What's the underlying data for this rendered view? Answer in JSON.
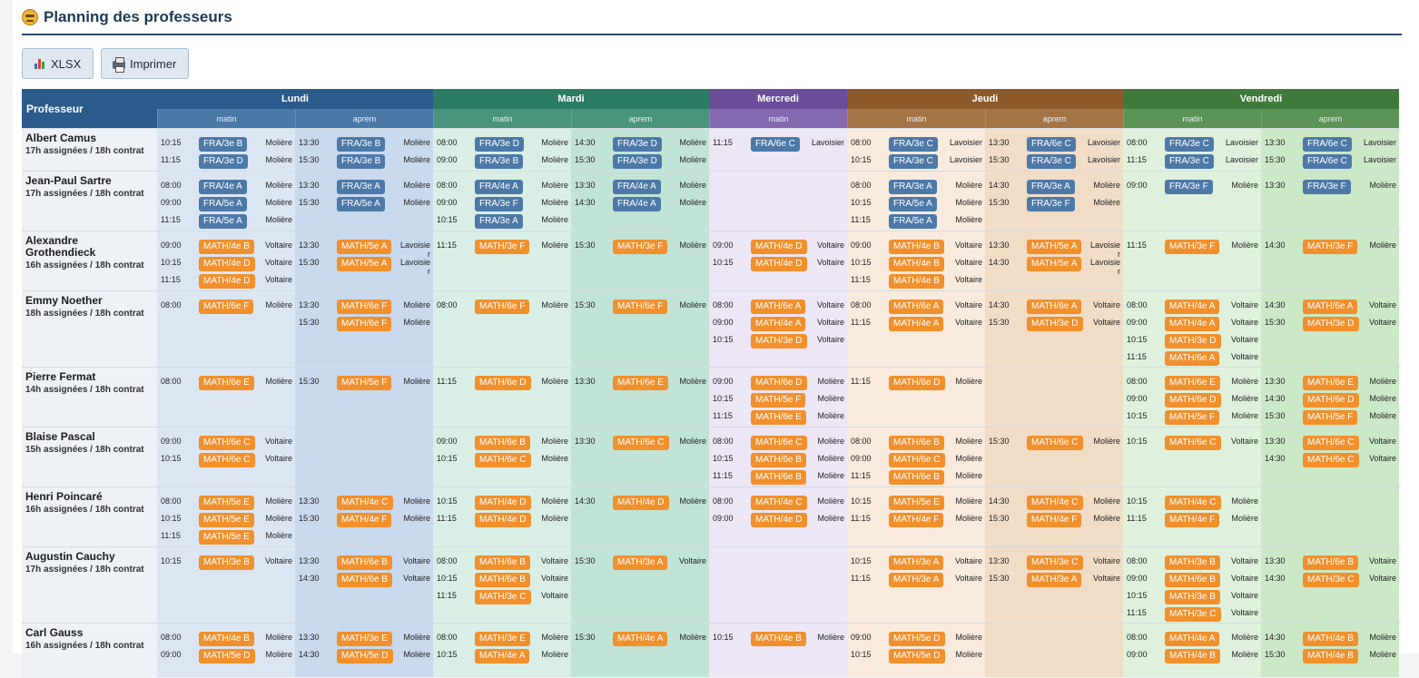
{
  "title": "Planning des professeurs",
  "toolbar": {
    "xlsx_label": "XLSX",
    "print_label": "Imprimer"
  },
  "table": {
    "prof_header": "Professeur",
    "days": [
      {
        "name": "Lundi",
        "color": "#2b5b8a",
        "sub_color": "#4a79a8",
        "slots": [
          "matin",
          "aprem"
        ]
      },
      {
        "name": "Mardi",
        "color": "#2a7c64",
        "sub_color": "#4a937c",
        "slots": [
          "matin",
          "aprem"
        ]
      },
      {
        "name": "Mercredi",
        "color": "#6a4c9b",
        "sub_color": "#8469b0",
        "slots": [
          "matin"
        ]
      },
      {
        "name": "Jeudi",
        "color": "#8c5a2a",
        "sub_color": "#a37446",
        "slots": [
          "matin",
          "aprem"
        ]
      },
      {
        "name": "Vendredi",
        "color": "#3f7a3a",
        "sub_color": "#5c9456",
        "slots": [
          "matin",
          "aprem"
        ]
      }
    ],
    "slot_bgs": [
      "#dce6f3",
      "#c9d9ee",
      "#d9efe5",
      "#c1e4d6",
      "#ece6f5",
      "#f8eadc",
      "#f1dcc6",
      "#dff1dc",
      "#cbe8c7"
    ],
    "professors": [
      {
        "name": "Albert Camus",
        "info": "17h assignées / 18h contrat",
        "slots": [
          [
            [
              "10:15",
              "FRA/3e B",
              "Molière"
            ],
            [
              "11:15",
              "FRA/3e D",
              "Molière"
            ]
          ],
          [
            [
              "13:30",
              "FRA/3e B",
              "Molière"
            ],
            [
              "15:30",
              "FRA/3e B",
              "Molière"
            ]
          ],
          [
            [
              "08:00",
              "FRA/3e D",
              "Molière"
            ],
            [
              "09:00",
              "FRA/3e B",
              "Molière"
            ]
          ],
          [
            [
              "14:30",
              "FRA/3e D",
              "Molière"
            ],
            [
              "15:30",
              "FRA/3e D",
              "Molière"
            ]
          ],
          [
            [
              "11:15",
              "FRA/6e C",
              "Lavoisier"
            ]
          ],
          [
            [
              "08:00",
              "FRA/3e C",
              "Lavoisier"
            ],
            [
              "10:15",
              "FRA/3e C",
              "Lavoisier"
            ]
          ],
          [
            [
              "13:30",
              "FRA/6e C",
              "Lavoisier"
            ],
            [
              "15:30",
              "FRA/3e C",
              "Lavoisier"
            ]
          ],
          [
            [
              "08:00",
              "FRA/3e C",
              "Lavoisier"
            ],
            [
              "11:15",
              "FRA/3e C",
              "Lavoisier"
            ]
          ],
          [
            [
              "13:30",
              "FRA/6e C",
              "Lavoisier"
            ],
            [
              "15:30",
              "FRA/6e C",
              "Lavoisier"
            ]
          ]
        ]
      },
      {
        "name": "Jean-Paul Sartre",
        "info": "17h assignées / 18h contrat",
        "slots": [
          [
            [
              "08:00",
              "FRA/4e A",
              "Molière"
            ],
            [
              "09:00",
              "FRA/5e A",
              "Molière"
            ],
            [
              "11:15",
              "FRA/5e A",
              "Molière"
            ]
          ],
          [
            [
              "13:30",
              "FRA/3e A",
              "Molière"
            ],
            [
              "15:30",
              "FRA/5e A",
              "Molière"
            ]
          ],
          [
            [
              "08:00",
              "FRA/4e A",
              "Molière"
            ],
            [
              "09:00",
              "FRA/3e F",
              "Molière"
            ],
            [
              "10:15",
              "FRA/3e A",
              "Molière"
            ]
          ],
          [
            [
              "13:30",
              "FRA/4e A",
              "Molière"
            ],
            [
              "14:30",
              "FRA/4e A",
              "Molière"
            ]
          ],
          [],
          [
            [
              "08:00",
              "FRA/3e A",
              "Molière"
            ],
            [
              "10:15",
              "FRA/5e A",
              "Molière"
            ],
            [
              "11:15",
              "FRA/5e A",
              "Molière"
            ]
          ],
          [
            [
              "14:30",
              "FRA/3e A",
              "Molière"
            ],
            [
              "15:30",
              "FRA/3e F",
              "Molière"
            ]
          ],
          [
            [
              "09:00",
              "FRA/3e F",
              "Molière"
            ]
          ],
          [
            [
              "13:30",
              "FRA/3e F",
              "Molière"
            ]
          ]
        ]
      },
      {
        "name": "Alexandre Grothendieck",
        "info": "16h assignées / 18h contrat",
        "slots": [
          [
            [
              "09:00",
              "MATH/4e B",
              "Voltaire"
            ],
            [
              "10:15",
              "MATH/4e D",
              "Voltaire"
            ],
            [
              "11:15",
              "MATH/4e D",
              "Voltaire"
            ]
          ],
          [
            [
              "13:30",
              "MATH/5e A",
              "Lavoisier"
            ],
            [
              "15:30",
              "MATH/5e A",
              "Lavoisier"
            ]
          ],
          [
            [
              "11:15",
              "MATH/3e F",
              "Molière"
            ]
          ],
          [
            [
              "15:30",
              "MATH/3e F",
              "Molière"
            ]
          ],
          [
            [
              "09:00",
              "MATH/4e D",
              "Voltaire"
            ],
            [
              "10:15",
              "MATH/4e D",
              "Voltaire"
            ]
          ],
          [
            [
              "09:00",
              "MATH/4e B",
              "Voltaire"
            ],
            [
              "10:15",
              "MATH/4e B",
              "Voltaire"
            ],
            [
              "11:15",
              "MATH/4e B",
              "Voltaire"
            ]
          ],
          [
            [
              "13:30",
              "MATH/5e A",
              "Lavoisier"
            ],
            [
              "14:30",
              "MATH/5e A",
              "Lavoisier"
            ]
          ],
          [
            [
              "11:15",
              "MATH/3e F",
              "Molière"
            ]
          ],
          [
            [
              "14:30",
              "MATH/3e F",
              "Molière"
            ]
          ]
        ]
      },
      {
        "name": "Emmy Noether",
        "info": "18h assignées / 18h contrat",
        "slots": [
          [
            [
              "08:00",
              "MATH/6e F",
              "Molière"
            ]
          ],
          [
            [
              "13:30",
              "MATH/6e F",
              "Molière"
            ],
            [
              "15:30",
              "MATH/6e F",
              "Molière"
            ]
          ],
          [
            [
              "08:00",
              "MATH/6e F",
              "Molière"
            ]
          ],
          [
            [
              "15:30",
              "MATH/6e F",
              "Molière"
            ]
          ],
          [
            [
              "08:00",
              "MATH/6e A",
              "Voltaire"
            ],
            [
              "09:00",
              "MATH/4e A",
              "Voltaire"
            ],
            [
              "10:15",
              "MATH/3e D",
              "Voltaire"
            ]
          ],
          [
            [
              "08:00",
              "MATH/6e A",
              "Voltaire"
            ],
            [
              "11:15",
              "MATH/4e A",
              "Voltaire"
            ]
          ],
          [
            [
              "14:30",
              "MATH/6e A",
              "Voltaire"
            ],
            [
              "15:30",
              "MATH/3e D",
              "Voltaire"
            ]
          ],
          [
            [
              "08:00",
              "MATH/4e A",
              "Voltaire"
            ],
            [
              "09:00",
              "MATH/4e A",
              "Voltaire"
            ],
            [
              "10:15",
              "MATH/3e D",
              "Voltaire"
            ],
            [
              "11:15",
              "MATH/6e A",
              "Voltaire"
            ]
          ],
          [
            [
              "14:30",
              "MATH/6e A",
              "Voltaire"
            ],
            [
              "15:30",
              "MATH/3e D",
              "Voltaire"
            ]
          ]
        ]
      },
      {
        "name": "Pierre Fermat",
        "info": "14h assignées / 18h contrat",
        "slots": [
          [
            [
              "08:00",
              "MATH/6e E",
              "Molière"
            ]
          ],
          [
            [
              "15:30",
              "MATH/5e F",
              "Molière"
            ]
          ],
          [
            [
              "11:15",
              "MATH/6e D",
              "Molière"
            ]
          ],
          [
            [
              "13:30",
              "MATH/6e E",
              "Molière"
            ]
          ],
          [
            [
              "09:00",
              "MATH/6e D",
              "Molière"
            ],
            [
              "10:15",
              "MATH/5e F",
              "Molière"
            ],
            [
              "11:15",
              "MATH/6e E",
              "Molière"
            ]
          ],
          [
            [
              "11:15",
              "MATH/6e D",
              "Molière"
            ]
          ],
          [],
          [
            [
              "08:00",
              "MATH/6e E",
              "Molière"
            ],
            [
              "09:00",
              "MATH/6e D",
              "Molière"
            ],
            [
              "10:15",
              "MATH/5e F",
              "Molière"
            ]
          ],
          [
            [
              "13:30",
              "MATH/6e E",
              "Molière"
            ],
            [
              "14:30",
              "MATH/6e D",
              "Molière"
            ],
            [
              "15:30",
              "MATH/5e F",
              "Molière"
            ]
          ]
        ]
      },
      {
        "name": "Blaise Pascal",
        "info": "15h assignées / 18h contrat",
        "slots": [
          [
            [
              "09:00",
              "MATH/6e C",
              "Voltaire"
            ],
            [
              "10:15",
              "MATH/6e C",
              "Voltaire"
            ]
          ],
          [],
          [
            [
              "09:00",
              "MATH/6e B",
              "Molière"
            ],
            [
              "10:15",
              "MATH/6e C",
              "Molière"
            ]
          ],
          [
            [
              "13:30",
              "MATH/6e C",
              "Molière"
            ]
          ],
          [
            [
              "08:00",
              "MATH/6e C",
              "Molière"
            ],
            [
              "10:15",
              "MATH/6e B",
              "Molière"
            ],
            [
              "11:15",
              "MATH/6e B",
              "Molière"
            ]
          ],
          [
            [
              "08:00",
              "MATH/6e B",
              "Molière"
            ],
            [
              "09:00",
              "MATH/6e C",
              "Molière"
            ],
            [
              "11:15",
              "MATH/6e B",
              "Molière"
            ]
          ],
          [
            [
              "15:30",
              "MATH/6e C",
              "Molière"
            ]
          ],
          [
            [
              "10:15",
              "MATH/6e C",
              "Voltaire"
            ]
          ],
          [
            [
              "13:30",
              "MATH/6e C",
              "Voltaire"
            ],
            [
              "14:30",
              "MATH/6e C",
              "Voltaire"
            ]
          ]
        ]
      },
      {
        "name": "Henri Poincaré",
        "info": "16h assignées / 18h contrat",
        "slots": [
          [
            [
              "08:00",
              "MATH/5e E",
              "Molière"
            ],
            [
              "10:15",
              "MATH/5e E",
              "Molière"
            ],
            [
              "11:15",
              "MATH/5e E",
              "Molière"
            ]
          ],
          [
            [
              "13:30",
              "MATH/4e C",
              "Molière"
            ],
            [
              "15:30",
              "MATH/4e F",
              "Molière"
            ]
          ],
          [
            [
              "10:15",
              "MATH/4e D",
              "Molière"
            ],
            [
              "11:15",
              "MATH/4e D",
              "Molière"
            ]
          ],
          [
            [
              "14:30",
              "MATH/4e D",
              "Molière"
            ]
          ],
          [
            [
              "08:00",
              "MATH/4e C",
              "Molière"
            ],
            [
              "09:00",
              "MATH/4e D",
              "Molière"
            ]
          ],
          [
            [
              "10:15",
              "MATH/5e E",
              "Molière"
            ],
            [
              "11:15",
              "MATH/4e F",
              "Molière"
            ]
          ],
          [
            [
              "14:30",
              "MATH/4e C",
              "Molière"
            ],
            [
              "15:30",
              "MATH/4e F",
              "Molière"
            ]
          ],
          [
            [
              "10:15",
              "MATH/4e C",
              "Molière"
            ],
            [
              "11:15",
              "MATH/4e F",
              "Molière"
            ]
          ],
          []
        ]
      },
      {
        "name": "Augustin Cauchy",
        "info": "17h assignées / 18h contrat",
        "slots": [
          [
            [
              "10:15",
              "MATH/3e B",
              "Voltaire"
            ]
          ],
          [
            [
              "13:30",
              "MATH/6e B",
              "Voltaire"
            ],
            [
              "14:30",
              "MATH/6e B",
              "Voltaire"
            ]
          ],
          [
            [
              "08:00",
              "MATH/6e B",
              "Voltaire"
            ],
            [
              "10:15",
              "MATH/6e B",
              "Voltaire"
            ],
            [
              "11:15",
              "MATH/3e C",
              "Voltaire"
            ]
          ],
          [
            [
              "15:30",
              "MATH/3e A",
              "Voltaire"
            ]
          ],
          [],
          [
            [
              "10:15",
              "MATH/3e A",
              "Voltaire"
            ],
            [
              "11:15",
              "MATH/3e A",
              "Voltaire"
            ]
          ],
          [
            [
              "13:30",
              "MATH/3e C",
              "Voltaire"
            ],
            [
              "15:30",
              "MATH/3e A",
              "Voltaire"
            ]
          ],
          [
            [
              "08:00",
              "MATH/3e B",
              "Voltaire"
            ],
            [
              "09:00",
              "MATH/6e B",
              "Voltaire"
            ],
            [
              "10:15",
              "MATH/3e B",
              "Voltaire"
            ],
            [
              "11:15",
              "MATH/3e C",
              "Voltaire"
            ]
          ],
          [
            [
              "13:30",
              "MATH/6e B",
              "Voltaire"
            ],
            [
              "14:30",
              "MATH/3e C",
              "Voltaire"
            ]
          ]
        ]
      },
      {
        "name": "Carl Gauss",
        "info": "16h assignées / 18h contrat",
        "slots": [
          [
            [
              "08:00",
              "MATH/4e B",
              "Molière"
            ],
            [
              "09:00",
              "MATH/5e D",
              "Molière"
            ]
          ],
          [
            [
              "13:30",
              "MATH/3e E",
              "Molière"
            ],
            [
              "14:30",
              "MATH/5e D",
              "Molière"
            ]
          ],
          [
            [
              "08:00",
              "MATH/3e E",
              "Molière"
            ],
            [
              "10:15",
              "MATH/4e A",
              "Molière"
            ]
          ],
          [
            [
              "15:30",
              "MATH/4e A",
              "Molière"
            ]
          ],
          [
            [
              "10:15",
              "MATH/4e B",
              "Molière"
            ]
          ],
          [
            [
              "09:00",
              "MATH/5e D",
              "Molière"
            ],
            [
              "10:15",
              "MATH/5e D",
              "Molière"
            ]
          ],
          [],
          [
            [
              "08:00",
              "MATH/4e A",
              "Molière"
            ],
            [
              "09:00",
              "MATH/4e B",
              "Molière"
            ]
          ],
          [
            [
              "14:30",
              "MATH/4e B",
              "Molière"
            ],
            [
              "15:30",
              "MATH/4e B",
              "Molière"
            ]
          ]
        ]
      }
    ]
  }
}
